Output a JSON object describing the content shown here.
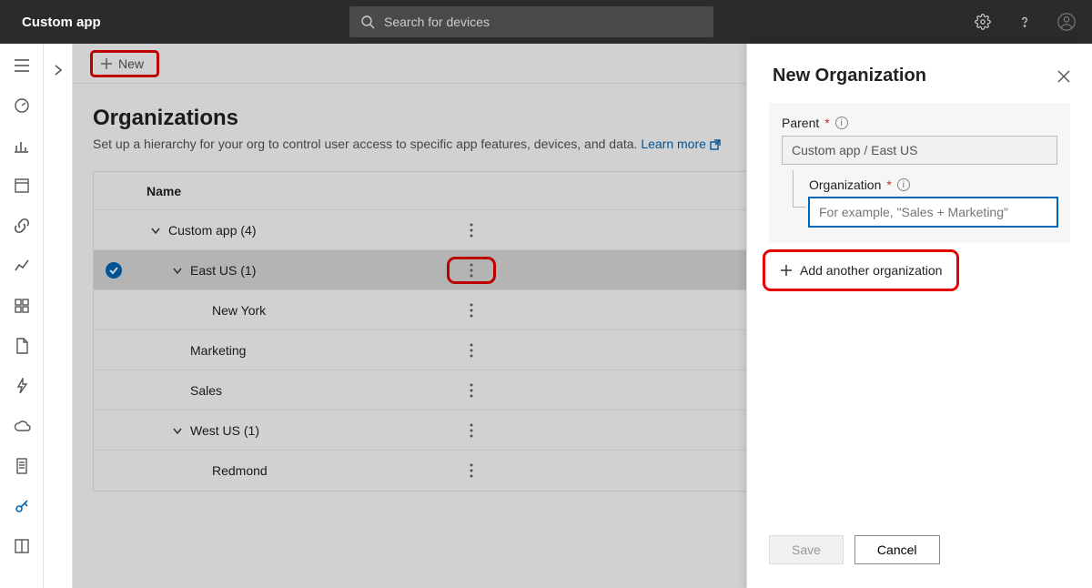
{
  "app_title": "Custom app",
  "search_placeholder": "Search for devices",
  "cmd_new": "New",
  "page_title": "Organizations",
  "page_subtitle": "Set up a hierarchy for your org to control user access to specific app features, devices, and data. ",
  "learn_more": "Learn more",
  "col_name": "Name",
  "rows": [
    {
      "label": "Custom app (4)",
      "indent": 0,
      "chev": true,
      "selected": false
    },
    {
      "label": "East US (1)",
      "indent": 1,
      "chev": true,
      "selected": true
    },
    {
      "label": "New York",
      "indent": 2,
      "chev": false,
      "selected": false
    },
    {
      "label": "Marketing",
      "indent": 1,
      "chev": false,
      "selected": false
    },
    {
      "label": "Sales",
      "indent": 1,
      "chev": false,
      "selected": false
    },
    {
      "label": "West US (1)",
      "indent": 1,
      "chev": true,
      "selected": false
    },
    {
      "label": "Redmond",
      "indent": 2,
      "chev": false,
      "selected": false
    }
  ],
  "flyout": {
    "title": "New Organization",
    "parent_label": "Parent",
    "parent_value": "Custom app / East US",
    "org_label": "Organization",
    "org_placeholder": "For example, \"Sales + Marketing\"",
    "add_another": "Add another organization",
    "save": "Save",
    "cancel": "Cancel"
  }
}
